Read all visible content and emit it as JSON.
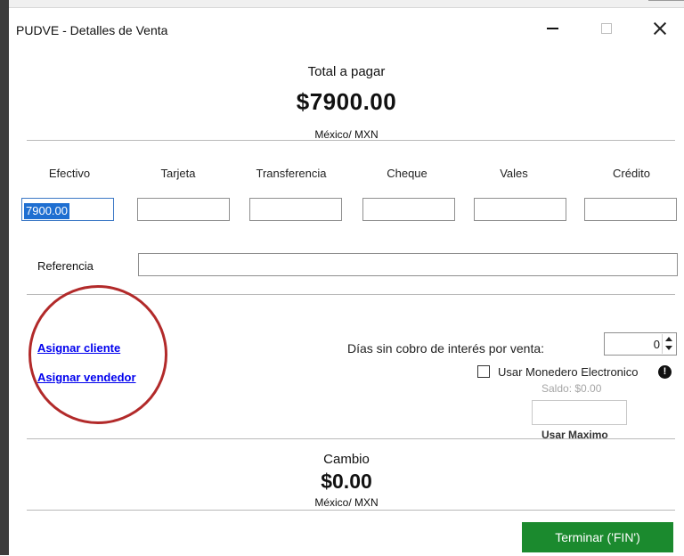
{
  "window": {
    "title": "PUDVE - Detalles de Venta"
  },
  "total": {
    "label": "Total a pagar",
    "amount": "$7900.00",
    "currency": "México/ MXN"
  },
  "payment_methods": [
    {
      "label": "Efectivo",
      "value": "7900.00"
    },
    {
      "label": "Tarjeta",
      "value": ""
    },
    {
      "label": "Transferencia",
      "value": ""
    },
    {
      "label": "Cheque",
      "value": ""
    },
    {
      "label": "Vales",
      "value": ""
    },
    {
      "label": "Crédito",
      "value": ""
    }
  ],
  "reference": {
    "label": "Referencia",
    "value": ""
  },
  "links": {
    "assign_client": "Asignar cliente",
    "assign_seller": "Asignar vendedor"
  },
  "days_interest": {
    "label": "Días sin cobro de interés por venta:",
    "value": "0"
  },
  "wallet": {
    "label": "Usar Monedero Electronico",
    "checked": false,
    "balance": "Saldo: $0.00",
    "max_label": "Usar Maximo"
  },
  "change": {
    "label": "Cambio",
    "amount": "$0.00",
    "currency": "México/ MXN"
  },
  "finish_button": "Terminar ('FIN')",
  "colors": {
    "link": "#0000ee",
    "finish_button": "#1b8a2e",
    "highlight_circle": "#b22a2a",
    "selection": "#1f6fd1"
  }
}
